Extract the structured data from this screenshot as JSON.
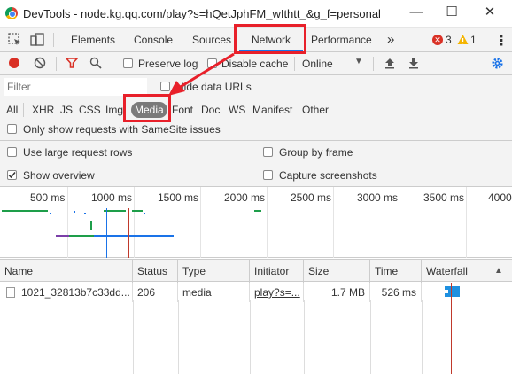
{
  "window": {
    "title": "DevTools - node.kg.qq.com/play?s=hQetJphFM_wIthtt_&g_f=personal",
    "minimize": "—",
    "maximize": "☐",
    "close": "✕"
  },
  "tabs": {
    "items": [
      {
        "label": "Elements"
      },
      {
        "label": "Console"
      },
      {
        "label": "Sources"
      },
      {
        "label": "Network"
      },
      {
        "label": "Performance"
      }
    ],
    "more": "»",
    "errors_count": "3",
    "warnings_count": "1",
    "kebab": "⋮"
  },
  "toolbar": {
    "preserve_log": "Preserve log",
    "disable_cache": "Disable cache",
    "throttling": "Online"
  },
  "filter": {
    "placeholder": "Filter",
    "hide_data_urls": "Hide data URLs",
    "types": [
      "All",
      "XHR",
      "JS",
      "CSS",
      "Img",
      "Media",
      "Font",
      "Doc",
      "WS",
      "Manifest",
      "Other"
    ],
    "selected_type": "Media",
    "samesite": "Only show requests with SameSite issues"
  },
  "settings": {
    "large_rows": "Use large request rows",
    "group_by_frame": "Group by frame",
    "show_overview": "Show overview",
    "capture_screenshots": "Capture screenshots",
    "show_overview_checked": true
  },
  "overview": {
    "ticks": [
      "500 ms",
      "1000 ms",
      "1500 ms",
      "2000 ms",
      "2500 ms",
      "3000 ms",
      "3500 ms",
      "4000"
    ]
  },
  "table": {
    "headers": {
      "name": "Name",
      "status": "Status",
      "type": "Type",
      "initiator": "Initiator",
      "size": "Size",
      "time": "Time",
      "waterfall": "Waterfall"
    },
    "rows": [
      {
        "name": "1021_32813b7c33dd...",
        "status": "206",
        "type": "media",
        "initiator": "play?s=...",
        "size": "1.7 MB",
        "time": "526 ms"
      }
    ]
  },
  "colors": {
    "highlight": "#e8202a",
    "accent": "#1a73e8",
    "record": "#d93025"
  }
}
